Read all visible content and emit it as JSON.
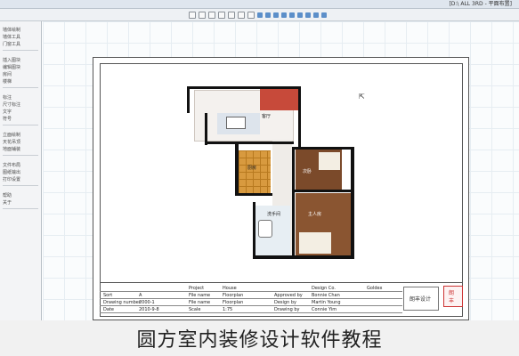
{
  "titlebar": {
    "title": "[D:\\ ALL 3RD - 平面布置]"
  },
  "toolbar": {
    "items": [
      "",
      "",
      "",
      "",
      "",
      "",
      "",
      "",
      "",
      "",
      "",
      "",
      "",
      "",
      "",
      ""
    ]
  },
  "sidebar": {
    "groups": [
      [
        "墙体绘制",
        "墙体工具",
        "门窗工具"
      ],
      [
        "插入图块",
        "编辑图块",
        "房间",
        "楼梯"
      ],
      [
        "标注",
        "尺寸标注",
        "文字",
        "符号"
      ],
      [
        "立面绘制",
        "天花吊顶",
        "地面铺装"
      ],
      [
        "文件布局",
        "图纸输出",
        "打印设置"
      ],
      [
        "帮助",
        "关于"
      ]
    ]
  },
  "plan": {
    "labels": {
      "living": "客厅",
      "kitchen": "厨房",
      "bedroom2": "次卧",
      "master": "主人房",
      "bath": "洗手间"
    }
  },
  "title_block": {
    "rows": [
      [
        "",
        "",
        "Project",
        "House",
        "",
        "Design Co.",
        "Goldex"
      ],
      [
        "Sort",
        "A",
        "File name",
        "Floorplan",
        "Approved by",
        "Bonnie Chan"
      ],
      [
        "Drawing number",
        "2000-1",
        "File name",
        "Floorplan",
        "Design by",
        "Martin Young"
      ],
      [
        "Date",
        "2010-9-8",
        "Scale",
        "1:75",
        "Drawing by",
        "Connie Yim"
      ]
    ],
    "logo_text": "朗丰设计",
    "stamp_text": "朗\n丰"
  },
  "caption": "圆方室内装修设计软件教程"
}
